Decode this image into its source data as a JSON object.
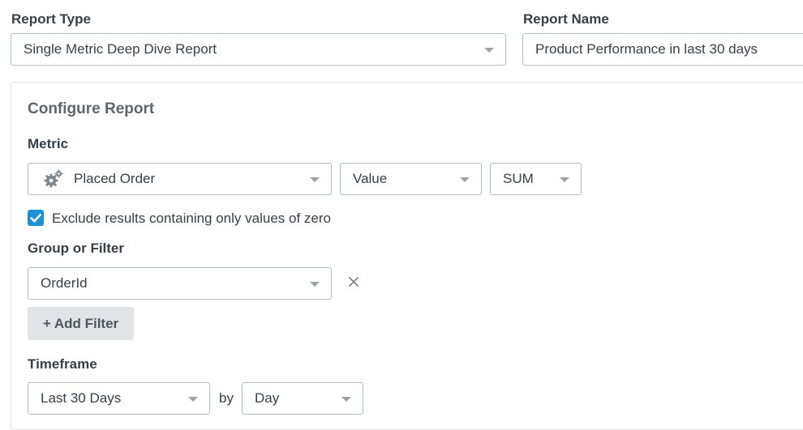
{
  "report_type": {
    "label": "Report Type",
    "value": "Single Metric Deep Dive Report"
  },
  "report_name": {
    "label": "Report Name",
    "value": "Product Performance in last 30 days"
  },
  "configure": {
    "title": "Configure Report",
    "metric": {
      "label": "Metric",
      "event": "Placed Order",
      "event_icon": "gears-icon",
      "measure": "Value",
      "aggregation": "SUM"
    },
    "exclude_zero": {
      "checked": true,
      "label": "Exclude results containing only values of zero"
    },
    "group_filter": {
      "label": "Group or Filter",
      "value": "OrderId",
      "add_filter_label": "+ Add Filter"
    },
    "timeframe": {
      "label": "Timeframe",
      "range": "Last 30 Days",
      "by_label": "by",
      "granularity": "Day"
    }
  },
  "colors": {
    "accent": "#1f8fd6",
    "border": "#b7bcc0",
    "text": "#373f47",
    "button_bg": "#e1e4e7"
  }
}
